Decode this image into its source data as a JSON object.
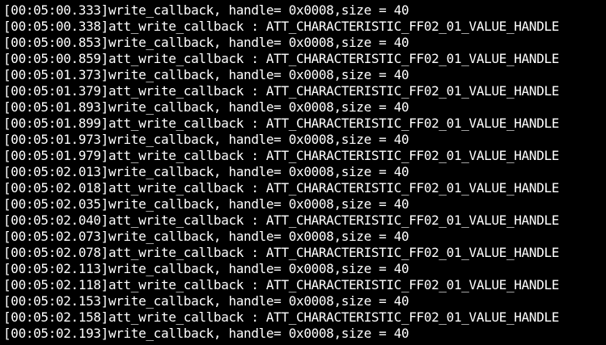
{
  "terminal": {
    "background": "#000000",
    "foreground": "#ffffff",
    "lines": [
      "[00:05:00.333]write_callback, handle= 0x0008,size = 40",
      "[00:05:00.338]att_write_callback : ATT_CHARACTERISTIC_FF02_01_VALUE_HANDLE",
      "[00:05:00.853]write_callback, handle= 0x0008,size = 40",
      "[00:05:00.859]att_write_callback : ATT_CHARACTERISTIC_FF02_01_VALUE_HANDLE",
      "[00:05:01.373]write_callback, handle= 0x0008,size = 40",
      "[00:05:01.379]att_write_callback : ATT_CHARACTERISTIC_FF02_01_VALUE_HANDLE",
      "[00:05:01.893]write_callback, handle= 0x0008,size = 40",
      "[00:05:01.899]att_write_callback : ATT_CHARACTERISTIC_FF02_01_VALUE_HANDLE",
      "[00:05:01.973]write_callback, handle= 0x0008,size = 40",
      "[00:05:01.979]att_write_callback : ATT_CHARACTERISTIC_FF02_01_VALUE_HANDLE",
      "[00:05:02.013]write_callback, handle= 0x0008,size = 40",
      "[00:05:02.018]att_write_callback : ATT_CHARACTERISTIC_FF02_01_VALUE_HANDLE",
      "[00:05:02.035]write_callback, handle= 0x0008,size = 40",
      "[00:05:02.040]att_write_callback : ATT_CHARACTERISTIC_FF02_01_VALUE_HANDLE",
      "[00:05:02.073]write_callback, handle= 0x0008,size = 40",
      "[00:05:02.078]att_write_callback : ATT_CHARACTERISTIC_FF02_01_VALUE_HANDLE",
      "[00:05:02.113]write_callback, handle= 0x0008,size = 40",
      "[00:05:02.118]att_write_callback : ATT_CHARACTERISTIC_FF02_01_VALUE_HANDLE",
      "[00:05:02.153]write_callback, handle= 0x0008,size = 40",
      "[00:05:02.158]att_write_callback : ATT_CHARACTERISTIC_FF02_01_VALUE_HANDLE",
      "[00:05:02.193]write_callback, handle= 0x0008,size = 40"
    ]
  }
}
